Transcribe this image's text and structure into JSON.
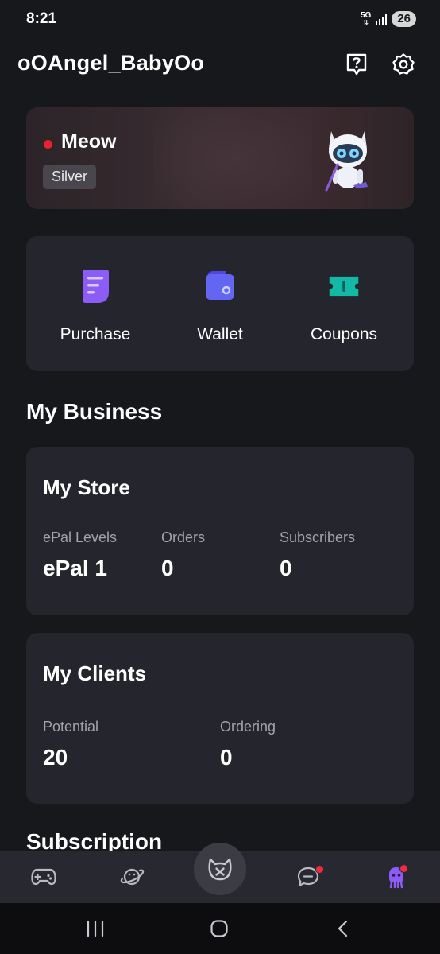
{
  "status_bar": {
    "time": "8:21",
    "network": "5G",
    "battery": "26"
  },
  "header": {
    "username": "oOAngel_BabyOo",
    "help_icon": "help-question-icon",
    "settings_icon": "gear-icon"
  },
  "profile": {
    "status_text": "Meow",
    "status_color": "#e8232e",
    "tier": "Silver",
    "mascot_icon": "cat-robot-mascot"
  },
  "quick_actions": [
    {
      "label": "Purchase",
      "icon": "document-list-icon",
      "color": "#8b5cf6"
    },
    {
      "label": "Wallet",
      "icon": "wallet-icon",
      "color": "#6366f1"
    },
    {
      "label": "Coupons",
      "icon": "ticket-icon",
      "color": "#14b8a6"
    }
  ],
  "my_business": {
    "title": "My Business",
    "store": {
      "title": "My Store",
      "stats": [
        {
          "label": "ePal Levels",
          "value": "ePal 1"
        },
        {
          "label": "Orders",
          "value": "0"
        },
        {
          "label": "Subscribers",
          "value": "0"
        }
      ]
    },
    "clients": {
      "title": "My Clients",
      "stats": [
        {
          "label": "Potential",
          "value": "20"
        },
        {
          "label": "Ordering",
          "value": "0"
        }
      ]
    }
  },
  "next_section": "Subscription",
  "bottom_nav": [
    {
      "name": "games",
      "icon": "gamepad-icon"
    },
    {
      "name": "explore",
      "icon": "planet-icon"
    },
    {
      "name": "home",
      "icon": "cat-face-icon"
    },
    {
      "name": "messages",
      "icon": "chat-bubble-icon",
      "has_badge": true
    },
    {
      "name": "profile",
      "icon": "avatar-icon",
      "has_badge": true
    }
  ],
  "system_nav": [
    "recents-icon",
    "home-icon",
    "back-icon"
  ]
}
